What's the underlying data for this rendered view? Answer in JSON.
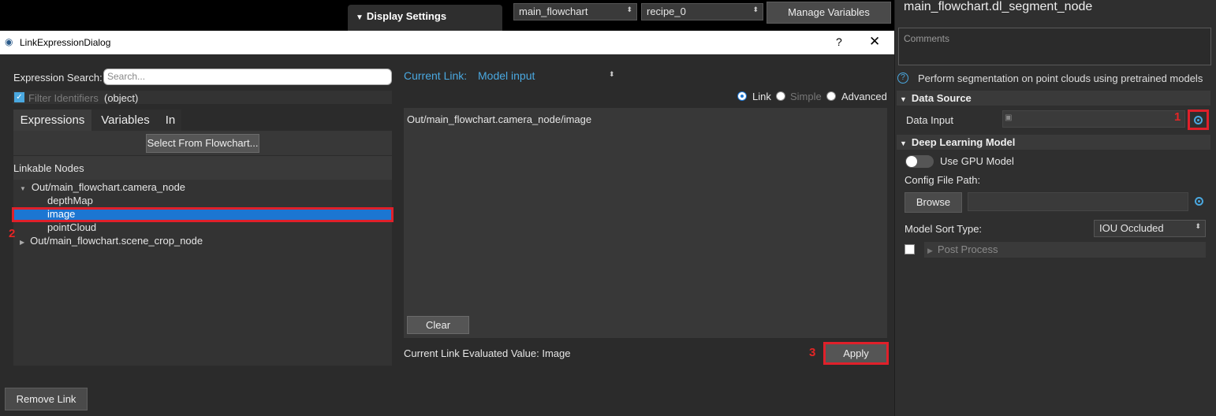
{
  "topbar": {
    "display_settings": "Display Settings",
    "flowchart_combo": "main_flowchart",
    "recipe_combo": "recipe_0",
    "manage_variables": "Manage Variables"
  },
  "node_panel": {
    "title": "main_flowchart.dl_segment_node",
    "comments_placeholder": "Comments",
    "description": "Perform segmentation on point clouds using pretrained models",
    "data_source_header": "Data Source",
    "data_input_label": "Data Input",
    "dl_model_header": "Deep Learning Model",
    "use_gpu_label": "Use GPU Model",
    "config_label": "Config File Path:",
    "browse_label": "Browse",
    "sort_label": "Model Sort Type:",
    "sort_value": "IOU Occluded",
    "post_process_label": "Post Process"
  },
  "dialog": {
    "title": "LinkExpressionDialog",
    "help": "?",
    "close": "✕",
    "expression_search_label": "Expression Search:",
    "search_placeholder": "Search...",
    "filter_label": "Filter Identifiers",
    "filter_value": "(object)",
    "tabs": [
      "Expressions",
      "Variables",
      "In"
    ],
    "select_from_flowchart": "Select From Flowchart...",
    "linkable_nodes_header": "Linkable Nodes",
    "tree": {
      "camera_node": "Out/main_flowchart.camera_node",
      "depth_map": "depthMap",
      "image": "image",
      "point_cloud": "pointCloud",
      "scene_crop_node": "Out/main_flowchart.scene_crop_node"
    },
    "current_link_label": "Current Link:",
    "current_link_value": "Model input",
    "radio_link": "Link",
    "radio_simple": "Simple",
    "radio_advanced": "Advanced",
    "expression_text": "Out/main_flowchart.camera_node/image",
    "clear_label": "Clear",
    "evaluated_value": "Current Link Evaluated Value: Image",
    "apply_label": "Apply",
    "remove_link_label": "Remove Link"
  },
  "annotations": {
    "marker_1": "1",
    "marker_2": "2",
    "marker_3": "3"
  },
  "colors": {
    "accent_blue": "#4aa8e0",
    "selection_blue": "#1c76d2",
    "highlight_red": "#e0202a"
  }
}
